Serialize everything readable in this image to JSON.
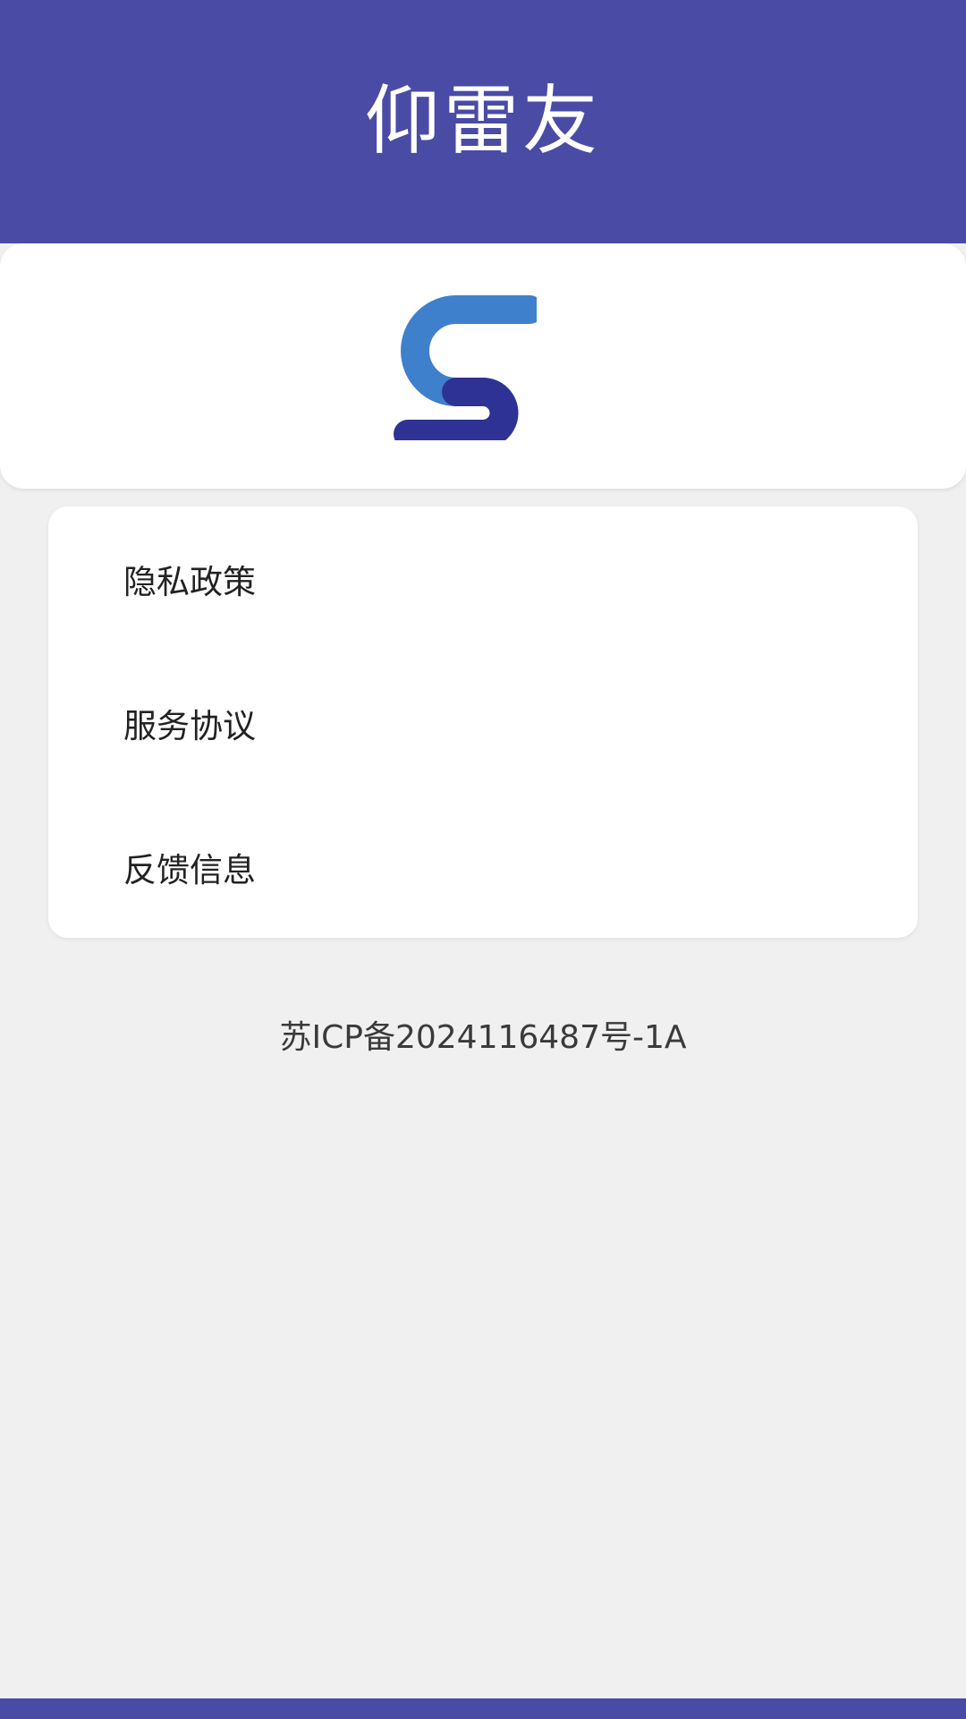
{
  "header": {
    "title": "仰雷友"
  },
  "logo": {
    "icon": "s-logo-icon",
    "colors": {
      "light_blue": "#3f80cc",
      "dark_blue": "#2d3294"
    }
  },
  "menu": {
    "items": [
      {
        "label": "隐私政策"
      },
      {
        "label": "服务协议"
      },
      {
        "label": "反馈信息"
      }
    ]
  },
  "footer": {
    "icp": "苏ICP备2024116487号-1A"
  },
  "colors": {
    "header_bg": "#4a4ba5",
    "page_bg": "#f0f0f0",
    "card_bg": "#ffffff"
  }
}
